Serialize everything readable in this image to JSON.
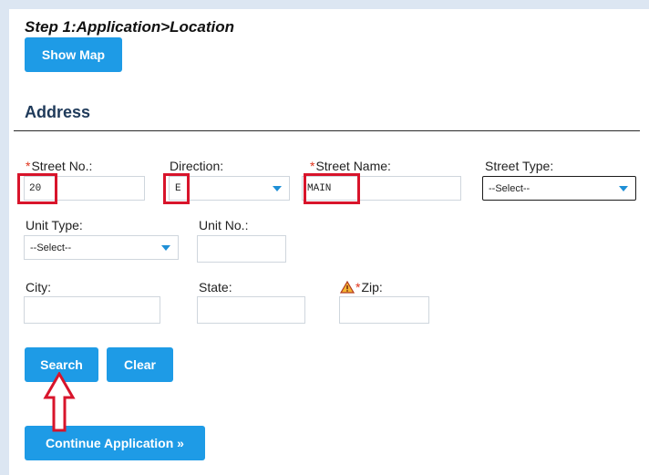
{
  "header": {
    "step_title": "Step 1:Application>Location"
  },
  "buttons": {
    "show_map": "Show Map",
    "search": "Search",
    "clear": "Clear",
    "continue": "Continue Application »"
  },
  "section": {
    "title": "Address"
  },
  "fields": {
    "street_no": {
      "label": "Street No.:",
      "value": "20"
    },
    "direction": {
      "label": "Direction:",
      "value": "E"
    },
    "street_name": {
      "label": "Street Name:",
      "value": "MAIN"
    },
    "street_type": {
      "label": "Street Type:",
      "value": "--Select--"
    },
    "unit_type": {
      "label": "Unit Type:",
      "value": "--Select--"
    },
    "unit_no": {
      "label": "Unit No.:",
      "value": ""
    },
    "city": {
      "label": "City:",
      "value": ""
    },
    "state": {
      "label": "State:",
      "value": ""
    },
    "zip": {
      "label": "Zip:",
      "value": ""
    }
  },
  "required_marker": "*",
  "colors": {
    "accent": "#1e9be6",
    "highlight": "#d8142b",
    "required": "#e0341c",
    "warning": "#f0a020"
  },
  "icons": {
    "warning": "warning-triangle-icon",
    "annotation": "up-arrow-annotation-icon"
  }
}
